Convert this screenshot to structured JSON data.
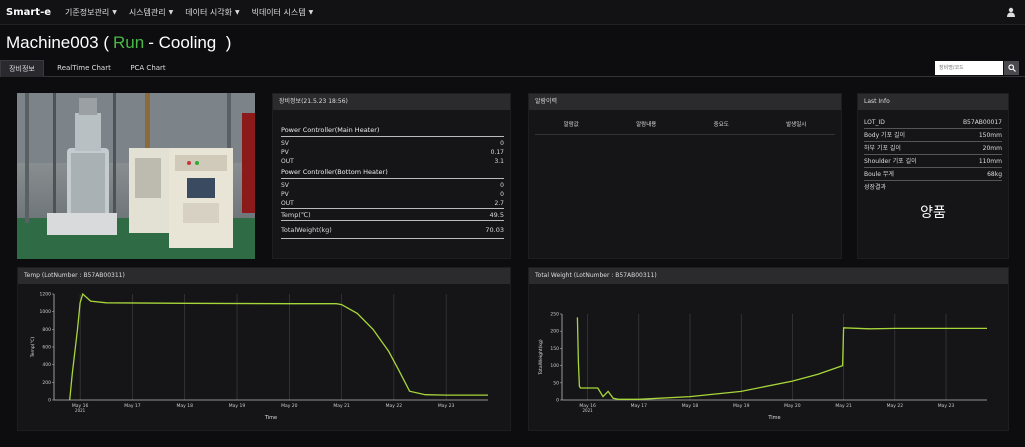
{
  "nav": {
    "brand": "Smart-e",
    "menus": [
      "기준정보관리",
      "시스템관리",
      "데이터 시각화",
      "빅데이터 시스템"
    ]
  },
  "title": {
    "machine": "Machine003",
    "paren_open": "(",
    "status": "Run",
    "phase": "- Cooling",
    "paren_close": ")",
    "status_color": "#49b947"
  },
  "tabs": [
    "장비정보",
    "RealTime Chart",
    "PCA Chart"
  ],
  "search": {
    "placeholder": "장비명/코드"
  },
  "equipment": {
    "header": "장비정보(21.5.23   18:56)",
    "main_heater": {
      "label": "Power Controller(Main Heater)",
      "rows": [
        {
          "k": "SV",
          "v": "0"
        },
        {
          "k": "PV",
          "v": "0.17"
        },
        {
          "k": "OUT",
          "v": "3.1"
        }
      ]
    },
    "bottom_heater": {
      "label": "Power Controller(Bottom Heater)",
      "rows": [
        {
          "k": "SV",
          "v": "0"
        },
        {
          "k": "PV",
          "v": "0"
        },
        {
          "k": "OUT",
          "v": "2.7"
        }
      ]
    },
    "temp": {
      "k": "Temp(℃)",
      "v": "49.5"
    },
    "weight": {
      "k": "TotalWeight(kg)",
      "v": "70.03"
    }
  },
  "alarm": {
    "header": "알람이력",
    "columns": [
      "알람값",
      "알람내용",
      "중요도",
      "발생일시"
    ]
  },
  "last_info": {
    "header": "Last Info",
    "rows": [
      {
        "k": "LOT_ID",
        "v": "B57AB00017"
      },
      {
        "k": "Body 기포 길이",
        "v": "150mm"
      },
      {
        "k": "하부 기포 길이",
        "v": "20mm"
      },
      {
        "k": "Shoulder 기포 길이",
        "v": "110mm"
      },
      {
        "k": "Boule 무게",
        "v": "68kg"
      }
    ],
    "result_label": "성장결과",
    "result_value": "양품"
  },
  "chart_data": [
    {
      "type": "line",
      "title": "Temp (LotNumber : B57AB00311)",
      "xlabel": "Time",
      "ylabel": "Temp(℃)",
      "ylim": [
        0,
        1200
      ],
      "yticks": [
        "0",
        "200",
        "400",
        "600",
        "800",
        "1000",
        "1200"
      ],
      "xticks": [
        "May 16",
        "May 17",
        "May 18",
        "May 19",
        "May 20",
        "May 21",
        "May 22",
        "May 23"
      ],
      "xticks_sub": "2021",
      "color": "#a7d63a",
      "series": [
        {
          "x": [
            15.8,
            15.85,
            15.95,
            16.0,
            16.05,
            16.2,
            16.5,
            18.0,
            20.0,
            20.9,
            21.0,
            21.3,
            21.6,
            21.9,
            22.1,
            22.3,
            22.6,
            23.0,
            23.8
          ],
          "y": [
            0,
            300,
            800,
            1100,
            1200,
            1120,
            1100,
            1095,
            1090,
            1090,
            1080,
            980,
            800,
            550,
            330,
            100,
            60,
            55,
            55
          ]
        }
      ]
    },
    {
      "type": "line",
      "title": "Total Weight (LotNumber : B57AB00311)",
      "xlabel": "Time",
      "ylabel": "TotalWeight(kg)",
      "ylim": [
        0,
        250
      ],
      "yticks": [
        "0",
        "50",
        "100",
        "150",
        "200",
        "250"
      ],
      "xticks": [
        "May 16",
        "May 17",
        "May 18",
        "May 19",
        "May 20",
        "May 21",
        "May 22",
        "May 23"
      ],
      "xticks_sub": "2021",
      "color": "#a7d63a",
      "series": [
        {
          "x": [
            15.8,
            15.82,
            15.84,
            15.86,
            16.2,
            16.3,
            16.4,
            16.5,
            16.6,
            17.0,
            18.0,
            19.0,
            20.0,
            20.5,
            20.98,
            21.0,
            21.5,
            22.0,
            23.8
          ],
          "y": [
            240,
            110,
            40,
            35,
            35,
            10,
            25,
            5,
            2,
            2,
            10,
            25,
            55,
            75,
            100,
            210,
            207,
            208,
            208
          ]
        }
      ]
    }
  ]
}
